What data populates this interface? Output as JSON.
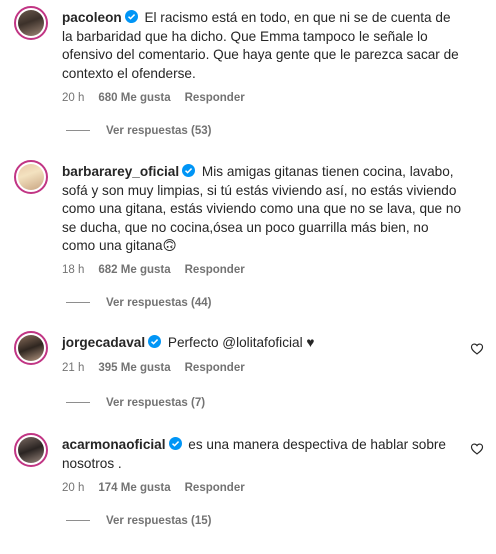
{
  "colors": {
    "verified": "#0095f6",
    "story_ring": "#c13584",
    "meta_text": "#737373",
    "text": "#262626"
  },
  "comments": [
    {
      "username": "pacoleon",
      "verified": true,
      "text": "El racismo está en todo, en que ni se de cuenta de la barbaridad que ha dicho. Que Emma tampoco le señale lo ofensivo del comentario. Que haya gente que le parezca sacar de contexto el ofenderse.",
      "time": "20 h",
      "likes": "680 Me gusta",
      "reply_label": "Responder",
      "view_replies": "Ver respuestas (53)"
    },
    {
      "username": "barbararey_oficial",
      "verified": true,
      "text": "Mis amigas gitanas tienen cocina, lavabo, sofá y son muy limpias, si tú estás viviendo así, no estás viviendo como una gitana, estás viviendo como una que no se lava, que no se ducha, que no cocina,ósea un poco guarrilla más bien, no como una gitana",
      "emoji": "🙃",
      "time": "18 h",
      "likes": "682 Me gusta",
      "reply_label": "Responder",
      "view_replies": "Ver respuestas (44)"
    },
    {
      "username": "jorgecadaval",
      "verified": true,
      "text": "Perfecto @lolitafoficial ♥",
      "time": "21 h",
      "likes": "395 Me gusta",
      "reply_label": "Responder",
      "view_replies": "Ver respuestas (7)"
    },
    {
      "username": "acarmonaoficial",
      "verified": true,
      "text": "es una manera despectiva de hablar sobre nosotros .",
      "time": "20 h",
      "likes": "174 Me gusta",
      "reply_label": "Responder",
      "view_replies": "Ver respuestas (15)"
    }
  ]
}
